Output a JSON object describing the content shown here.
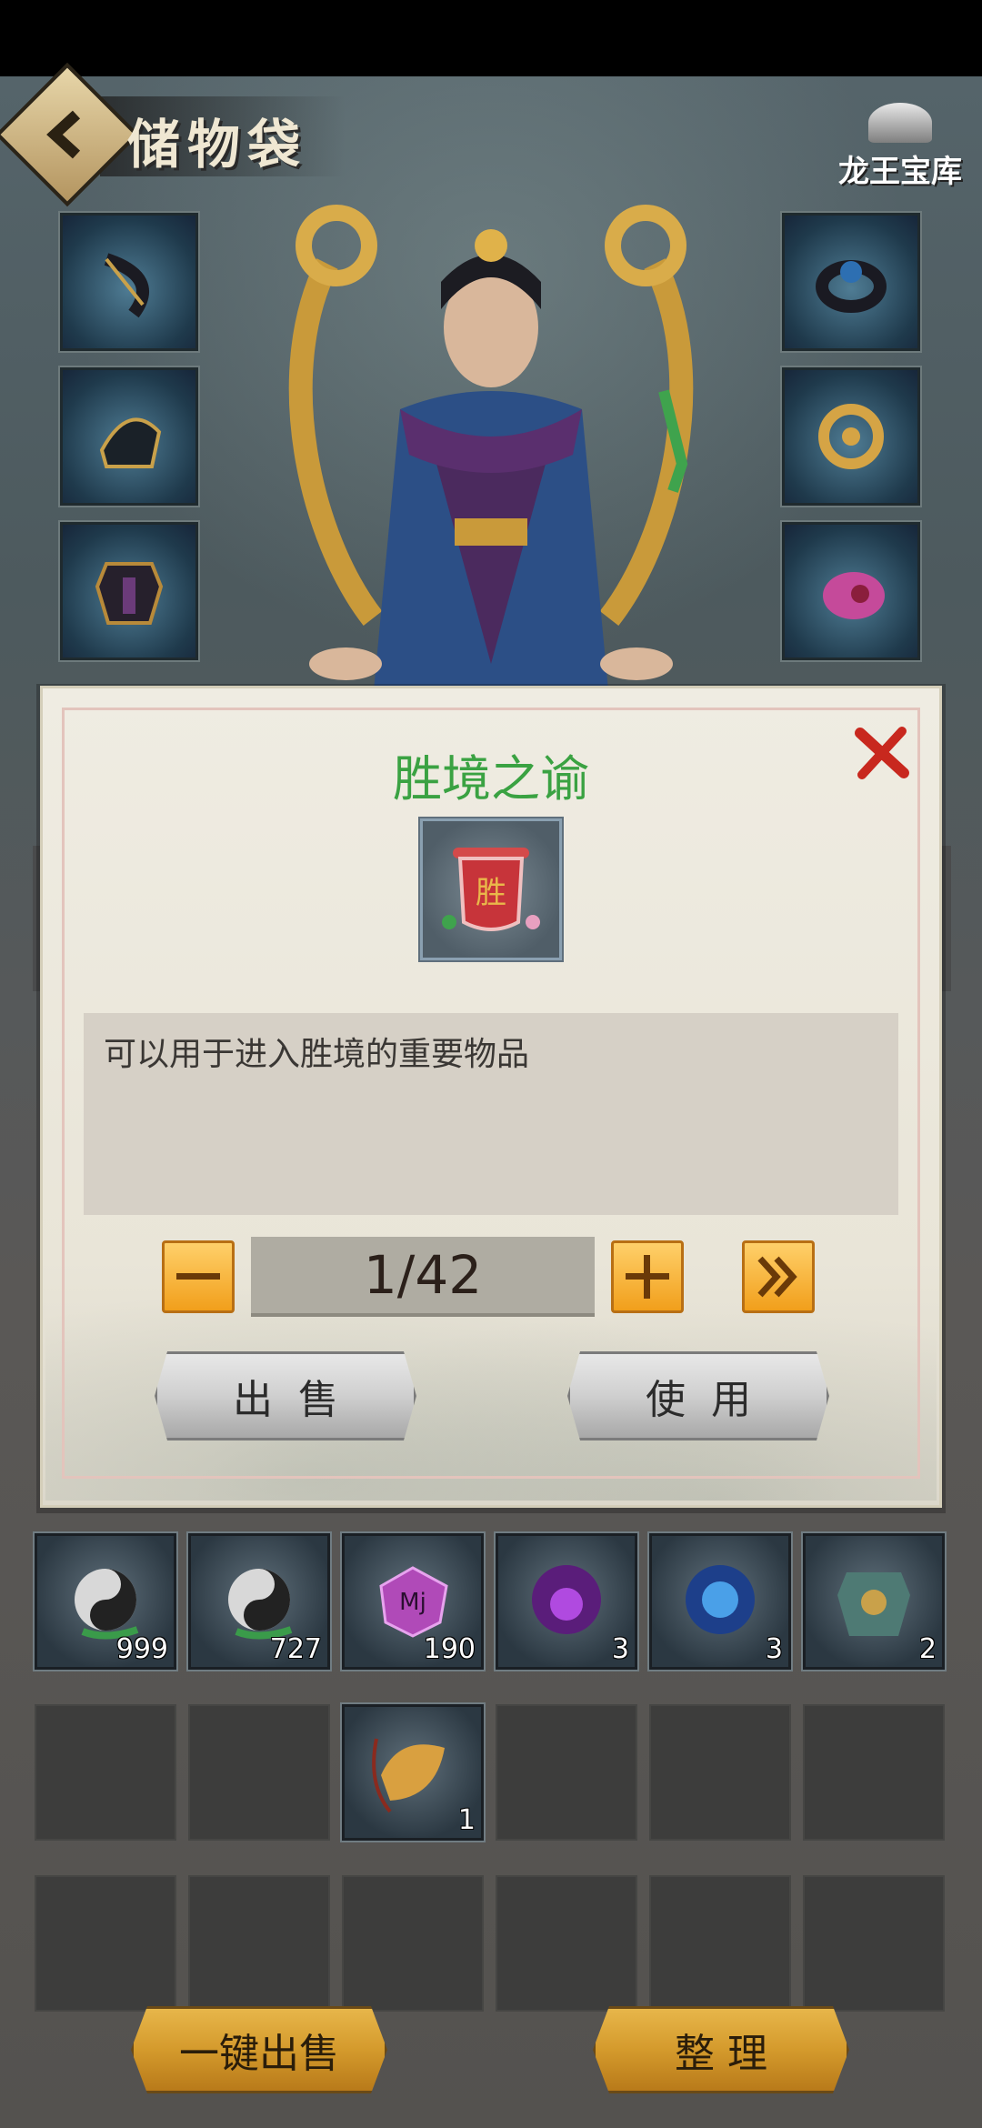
{
  "header": {
    "title": "储物袋",
    "treasury_label": "龙王宝库"
  },
  "equipment": {
    "left": [
      "bow-icon",
      "helmet-icon",
      "armor-icon"
    ],
    "right": [
      "ring-icon",
      "dragon-amulet-icon",
      "fish-charm-icon"
    ]
  },
  "popup": {
    "title": "胜境之谕",
    "item_icon": "scroll-banner-icon",
    "description": "可以用于进入胜境的重要物品",
    "quantity": "1/42",
    "minus_icon": "minus-icon",
    "plus_icon": "plus-icon",
    "max_icon": "double-chevron-right-icon",
    "sell_label": "出售",
    "use_label": "使用"
  },
  "inventory": {
    "rows": [
      [
        {
          "icon": "yin-yang-gourd-icon",
          "count": "999"
        },
        {
          "icon": "yin-yang-gourd-icon",
          "count": "727"
        },
        {
          "icon": "purple-gem-icon",
          "count": "190"
        },
        {
          "icon": "purple-orb-icon",
          "count": "3"
        },
        {
          "icon": "blue-orb-icon",
          "count": "3"
        },
        {
          "icon": "armor-vest-icon",
          "count": "2"
        }
      ],
      [
        null,
        null,
        {
          "icon": "golden-charm-icon",
          "count": "1"
        },
        null,
        null,
        null
      ],
      [
        null,
        null,
        null,
        null,
        null,
        null
      ]
    ]
  },
  "footer": {
    "sell_all_label": "一键出售",
    "sort_label": "整 理"
  },
  "colors": {
    "title_green": "#3aa242",
    "close_red": "#c8281e",
    "gold_button": "#f19f1b"
  }
}
